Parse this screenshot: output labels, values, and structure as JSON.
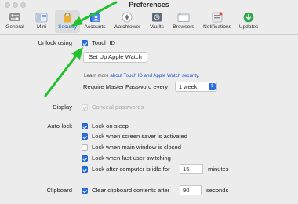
{
  "window": {
    "title": "Preferences"
  },
  "toolbar": {
    "items": [
      {
        "label": "General",
        "icon": "switch-icon"
      },
      {
        "label": "Mini",
        "icon": "mini-window-icon"
      },
      {
        "label": "Security",
        "icon": "lock-icon",
        "active": true
      },
      {
        "label": "Accounts",
        "icon": "accounts-icon"
      },
      {
        "label": "Watchtower",
        "icon": "watchtower-icon"
      },
      {
        "label": "Vaults",
        "icon": "vaults-icon"
      },
      {
        "label": "Browsers",
        "icon": "browsers-icon"
      },
      {
        "label": "Notifications",
        "icon": "notifications-icon"
      },
      {
        "label": "Updates",
        "icon": "updates-icon"
      }
    ]
  },
  "unlock": {
    "section_label": "Unlock using",
    "touch_id": {
      "label": "Touch ID",
      "checked": true
    },
    "setup_button": "Set Up Apple Watch",
    "learn_more_prefix": "Learn more",
    "learn_more_link": "about Touch ID and Apple Watch security.",
    "require_label": "Require Master Password every",
    "require_value": "1 week"
  },
  "display": {
    "section_label": "Display",
    "conceal": {
      "label": "Conceal passwords",
      "checked": true,
      "disabled": true
    }
  },
  "autolock": {
    "section_label": "Auto-lock",
    "options": [
      {
        "label": "Lock on sleep",
        "checked": true
      },
      {
        "label": "Lock when screen saver is activated",
        "checked": true
      },
      {
        "label": "Lock when main window is closed",
        "checked": false
      },
      {
        "label": "Lock when fast user switching",
        "checked": true
      },
      {
        "label": "Lock after computer is idle for",
        "checked": true
      }
    ],
    "idle_value": "15",
    "idle_unit": "minutes"
  },
  "clipboard": {
    "section_label": "Clipboard",
    "clear": {
      "label": "Clear clipboard contents after",
      "checked": true
    },
    "clear_value": "90",
    "clear_unit": "seconds"
  },
  "colors": {
    "accent": "#2a6fe0",
    "annotation_arrow": "#22c12e"
  }
}
